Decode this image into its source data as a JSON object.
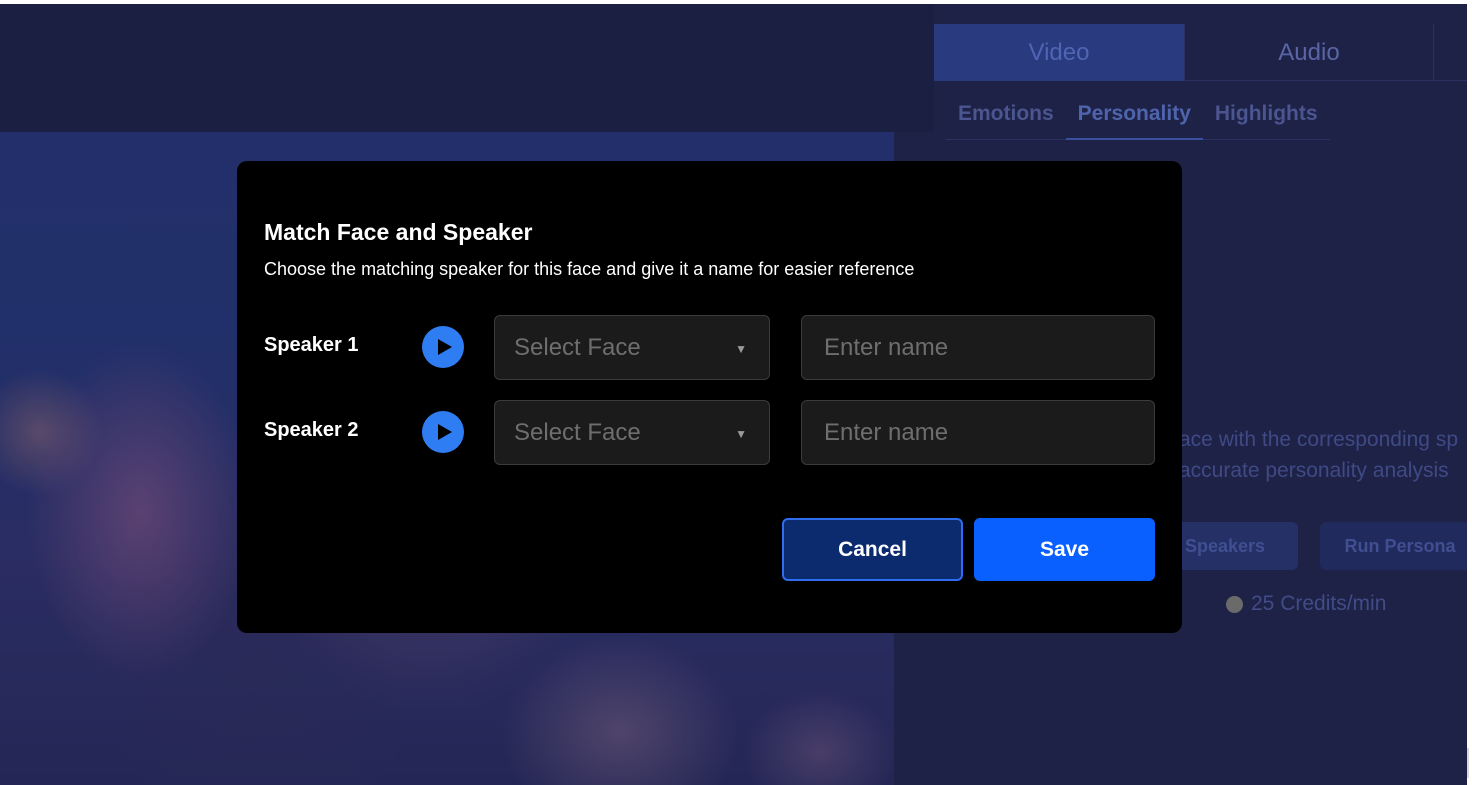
{
  "side_panel": {
    "tabs": [
      {
        "label": "Video"
      },
      {
        "label": "Audio"
      }
    ],
    "subtabs": [
      {
        "label": "Emotions"
      },
      {
        "label": "Personality"
      },
      {
        "label": "Highlights"
      }
    ],
    "description_line1": "ace with the corresponding sp",
    "description_line2": "accurate personality analysis",
    "match_button_label": "& Speakers",
    "run_button_label": "Run Persona",
    "credits": "25 Credits/min"
  },
  "modal": {
    "title": "Match Face and Speaker",
    "subtitle": "Choose the matching speaker for this face and give it a name for easier reference",
    "speakers": [
      {
        "label": "Speaker 1",
        "select_placeholder": "Select Face",
        "name_placeholder": "Enter name"
      },
      {
        "label": "Speaker 2",
        "select_placeholder": "Select Face",
        "name_placeholder": "Enter name"
      }
    ],
    "cancel_label": "Cancel",
    "save_label": "Save"
  },
  "colors": {
    "accent_blue": "#0a60ff",
    "play_blue": "#2f7df3",
    "modal_bg": "#000000",
    "backdrop": "#1e2247"
  }
}
